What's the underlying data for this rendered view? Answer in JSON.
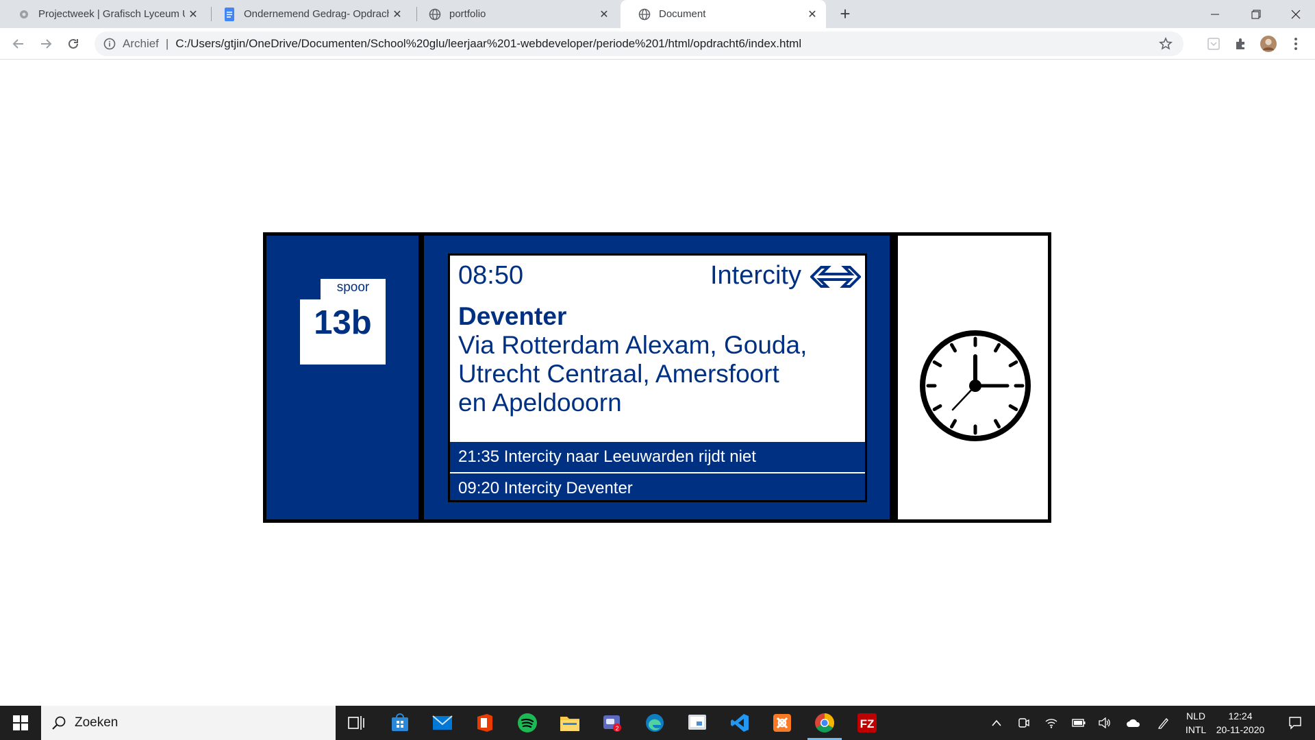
{
  "browser": {
    "tabs": [
      {
        "title": "Projectweek | Grafisch Lyceum Ut",
        "favicon": "grafisch-lyceum-icon"
      },
      {
        "title": "Ondernemend Gedrag- Opdracht",
        "favicon": "google-docs-icon"
      },
      {
        "title": "portfolio",
        "favicon": "globe-icon"
      },
      {
        "title": "Document",
        "favicon": "globe-icon",
        "active": true
      }
    ],
    "address_bar": {
      "scheme_label": "Archief",
      "separator": "|",
      "url": "C:/Users/gtjin/OneDrive/Documenten/School%20glu/leerjaar%201-webdeveloper/periode%201/html/opdracht6/index.html"
    }
  },
  "board": {
    "platform": {
      "label": "spoor",
      "number": "13b"
    },
    "departure": {
      "time": "08:50",
      "train_type": "Intercity",
      "destination": "Deventer",
      "via_lines": [
        "Via Rotterdam Alexam, Gouda,",
        "Utrecht Centraal, Amersfoort",
        "en Apeldooorn"
      ]
    },
    "next_departures": [
      "21:35 Intercity naar Leeuwarden rijdt niet",
      "09:20 Intercity Deventer"
    ],
    "colors": {
      "ns_blue": "#003082",
      "white": "#ffffff",
      "black": "#000000"
    }
  },
  "taskbar": {
    "search_placeholder": "Zoeken",
    "language": {
      "line1": "NLD",
      "line2": "INTL"
    },
    "clock": {
      "time": "12:24",
      "date": "20-11-2020"
    },
    "pinned_icons": [
      "task-view-icon",
      "store-icon",
      "mail-icon",
      "office-icon",
      "spotify-icon",
      "file-explorer-icon",
      "game-bar-icon",
      "edge-icon",
      "snip-icon",
      "vscode-icon",
      "xampp-icon",
      "chrome-icon",
      "filezilla-icon"
    ],
    "mail_badge": "2"
  }
}
